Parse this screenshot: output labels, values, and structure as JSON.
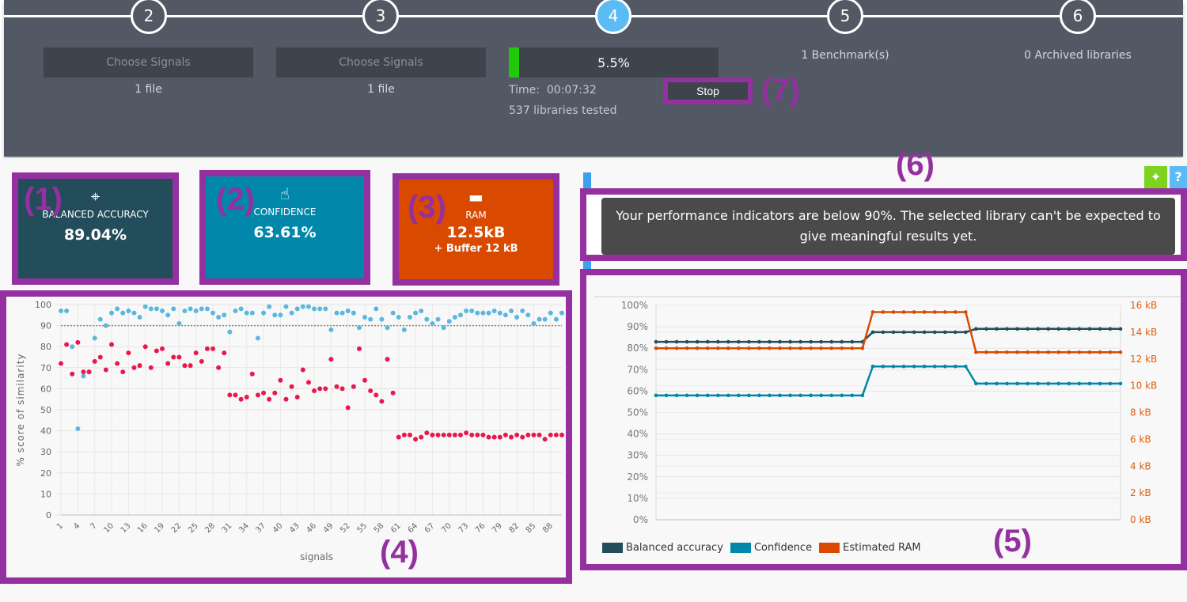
{
  "stepper": {
    "steps": [
      "2",
      "3",
      "4",
      "5",
      "6"
    ],
    "active": "4",
    "active_color": "#5bbcf5"
  },
  "step2": {
    "button": "Choose Signals",
    "files": "1 file"
  },
  "step3": {
    "button": "Choose Signals",
    "files": "1 file"
  },
  "step4": {
    "progress_percent": 5.5,
    "progress_label": "5.5%",
    "time_label": "Time:",
    "time": "00:07:32",
    "libraries_tested": "537 libraries tested",
    "stop_button": "Stop"
  },
  "step5": {
    "label": "1 Benchmark(s)"
  },
  "step6": {
    "label": "0 Archived libraries"
  },
  "cards": [
    {
      "title": "BALANCED ACCURACY",
      "value": "89.04%",
      "icon": "target-icon",
      "color": "#234d5a"
    },
    {
      "title": "CONFIDENCE",
      "value": "63.61%",
      "icon": "tap-icon",
      "color": "#0087aa"
    },
    {
      "title": "RAM",
      "value": "12.5kB",
      "extra": "+ Buffer 12 kB",
      "icon": "ram-chip-icon",
      "color": "#d94a00"
    }
  ],
  "message": "Your performance indicators are below 90%. The selected library can't be expected to give meaningful results yet.",
  "annotations": [
    "(1)",
    "(2)",
    "(3)",
    "(4)",
    "(5)",
    "(6)",
    "(7)"
  ],
  "chart_data": [
    {
      "type": "scatter",
      "xlabel": "signals",
      "ylabel": "% score of similarity",
      "ylim": [
        0,
        100
      ],
      "yticks": [
        0,
        10,
        20,
        30,
        40,
        50,
        60,
        70,
        80,
        90,
        100
      ],
      "xticks": [
        1,
        4,
        7,
        10,
        13,
        16,
        19,
        22,
        25,
        28,
        31,
        34,
        37,
        40,
        43,
        46,
        49,
        52,
        55,
        58,
        61,
        64,
        67,
        70,
        73,
        76,
        79,
        82,
        85,
        88
      ],
      "reference_line": 90,
      "grid": true,
      "series": [
        {
          "color": "#5bb8dc",
          "values": [
            97,
            97,
            80,
            41,
            66,
            68,
            84,
            93,
            90,
            96,
            98,
            96,
            97,
            96,
            94,
            99,
            98,
            98,
            97,
            95,
            98,
            91,
            97,
            98,
            97,
            98,
            98,
            96,
            94,
            95,
            87,
            97,
            98,
            96,
            96,
            84,
            96,
            99,
            95,
            95,
            99,
            96,
            98,
            99,
            99,
            98,
            98,
            98,
            88,
            96,
            96,
            97,
            96,
            89,
            94,
            93,
            98,
            93,
            89,
            96,
            94,
            88,
            94,
            96,
            97,
            93,
            91,
            93,
            89,
            92,
            94,
            95,
            97,
            97,
            96,
            96,
            96,
            97,
            96,
            95,
            97,
            94,
            97,
            95,
            91,
            93,
            93,
            96,
            93,
            96
          ]
        },
        {
          "color": "#e8194a",
          "values": [
            72,
            81,
            67,
            82,
            68,
            68,
            73,
            75,
            69,
            81,
            72,
            68,
            77,
            70,
            71,
            80,
            70,
            78,
            79,
            72,
            75,
            75,
            71,
            71,
            77,
            73,
            79,
            79,
            70,
            77,
            57,
            57,
            55,
            56,
            67,
            57,
            58,
            55,
            58,
            64,
            55,
            61,
            56,
            69,
            63,
            59,
            60,
            60,
            74,
            61,
            60,
            51,
            61,
            79,
            64,
            59,
            57,
            54,
            74,
            58,
            37,
            38,
            38,
            36,
            37,
            39,
            38,
            38,
            38,
            38,
            38,
            38,
            39,
            38,
            38,
            38,
            37,
            37,
            37,
            38,
            37,
            38,
            37,
            38,
            38,
            38,
            36,
            38,
            38,
            38
          ]
        }
      ]
    },
    {
      "type": "line",
      "ylim": [
        0,
        100
      ],
      "y2lim": [
        0,
        16
      ],
      "yticks": [
        "0%",
        "10%",
        "20%",
        "30%",
        "40%",
        "50%",
        "60%",
        "70%",
        "80%",
        "90%",
        "100%"
      ],
      "y2ticks": [
        "0 kB",
        "2 kB",
        "4 kB",
        "6 kB",
        "8 kB",
        "10 kB",
        "12 kB",
        "14 kB",
        "16 kB"
      ],
      "legend_position": "bottom-left",
      "grid": true,
      "series": [
        {
          "name": "Balanced accuracy",
          "color": "#234d5a",
          "axis": "left",
          "segments": [
            [
              21,
              83
            ],
            [
              10,
              87.5
            ],
            [
              15,
              89
            ]
          ]
        },
        {
          "name": "Confidence",
          "color": "#0087aa",
          "axis": "left",
          "segments": [
            [
              21,
              58
            ],
            [
              10,
              71.5
            ],
            [
              15,
              63.5
            ]
          ]
        },
        {
          "name": "Estimated RAM",
          "color": "#d94a00",
          "axis": "right",
          "segments": [
            [
              21,
              12.8
            ],
            [
              10,
              15.5
            ],
            [
              15,
              12.5
            ]
          ]
        }
      ]
    }
  ]
}
